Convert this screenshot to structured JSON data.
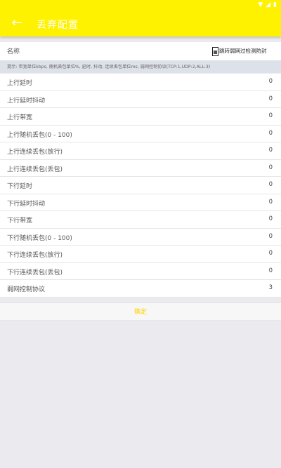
{
  "status_bar": {
    "icons": [
      "signal-icon",
      "wifi-icon",
      "battery-icon"
    ],
    "glyphs": [
      "▼",
      "◢",
      "▮"
    ]
  },
  "app_bar": {
    "back_glyph": "←",
    "title": "丢弃配置",
    "color": "#fff200"
  },
  "name_row": {
    "label": "名称",
    "checkbox_label": "跳转弱网过检测防封"
  },
  "hint": "提示: 带宽单位kbps, 随机丢包单位%, 延时, 抖动, 连续丢包单位ms, 弱网控制协议(TCP:1,UDP:2,ALL:3)",
  "rows": [
    {
      "label": "上行延时",
      "value": "0"
    },
    {
      "label": "上行延时抖动",
      "value": "0"
    },
    {
      "label": "上行带宽",
      "value": "0"
    },
    {
      "label": "上行随机丢包(0 - 100)",
      "value": "0"
    },
    {
      "label": "上行连续丢包(放行)",
      "value": "0"
    },
    {
      "label": "上行连续丢包(丢包)",
      "value": "0"
    },
    {
      "label": "下行延时",
      "value": "0"
    },
    {
      "label": "下行延时抖动",
      "value": "0"
    },
    {
      "label": "下行带宽",
      "value": "0"
    },
    {
      "label": "下行随机丢包(0 - 100)",
      "value": "0"
    },
    {
      "label": "下行连续丢包(放行)",
      "value": "0"
    },
    {
      "label": "下行连续丢包(丢包)",
      "value": "0"
    },
    {
      "label": "弱网控制协议",
      "value": "3"
    }
  ],
  "confirm_label": "确定",
  "colors": {
    "accent": "#fff200",
    "confirm_text": "#ffd400",
    "page_background": "#ebebef"
  }
}
